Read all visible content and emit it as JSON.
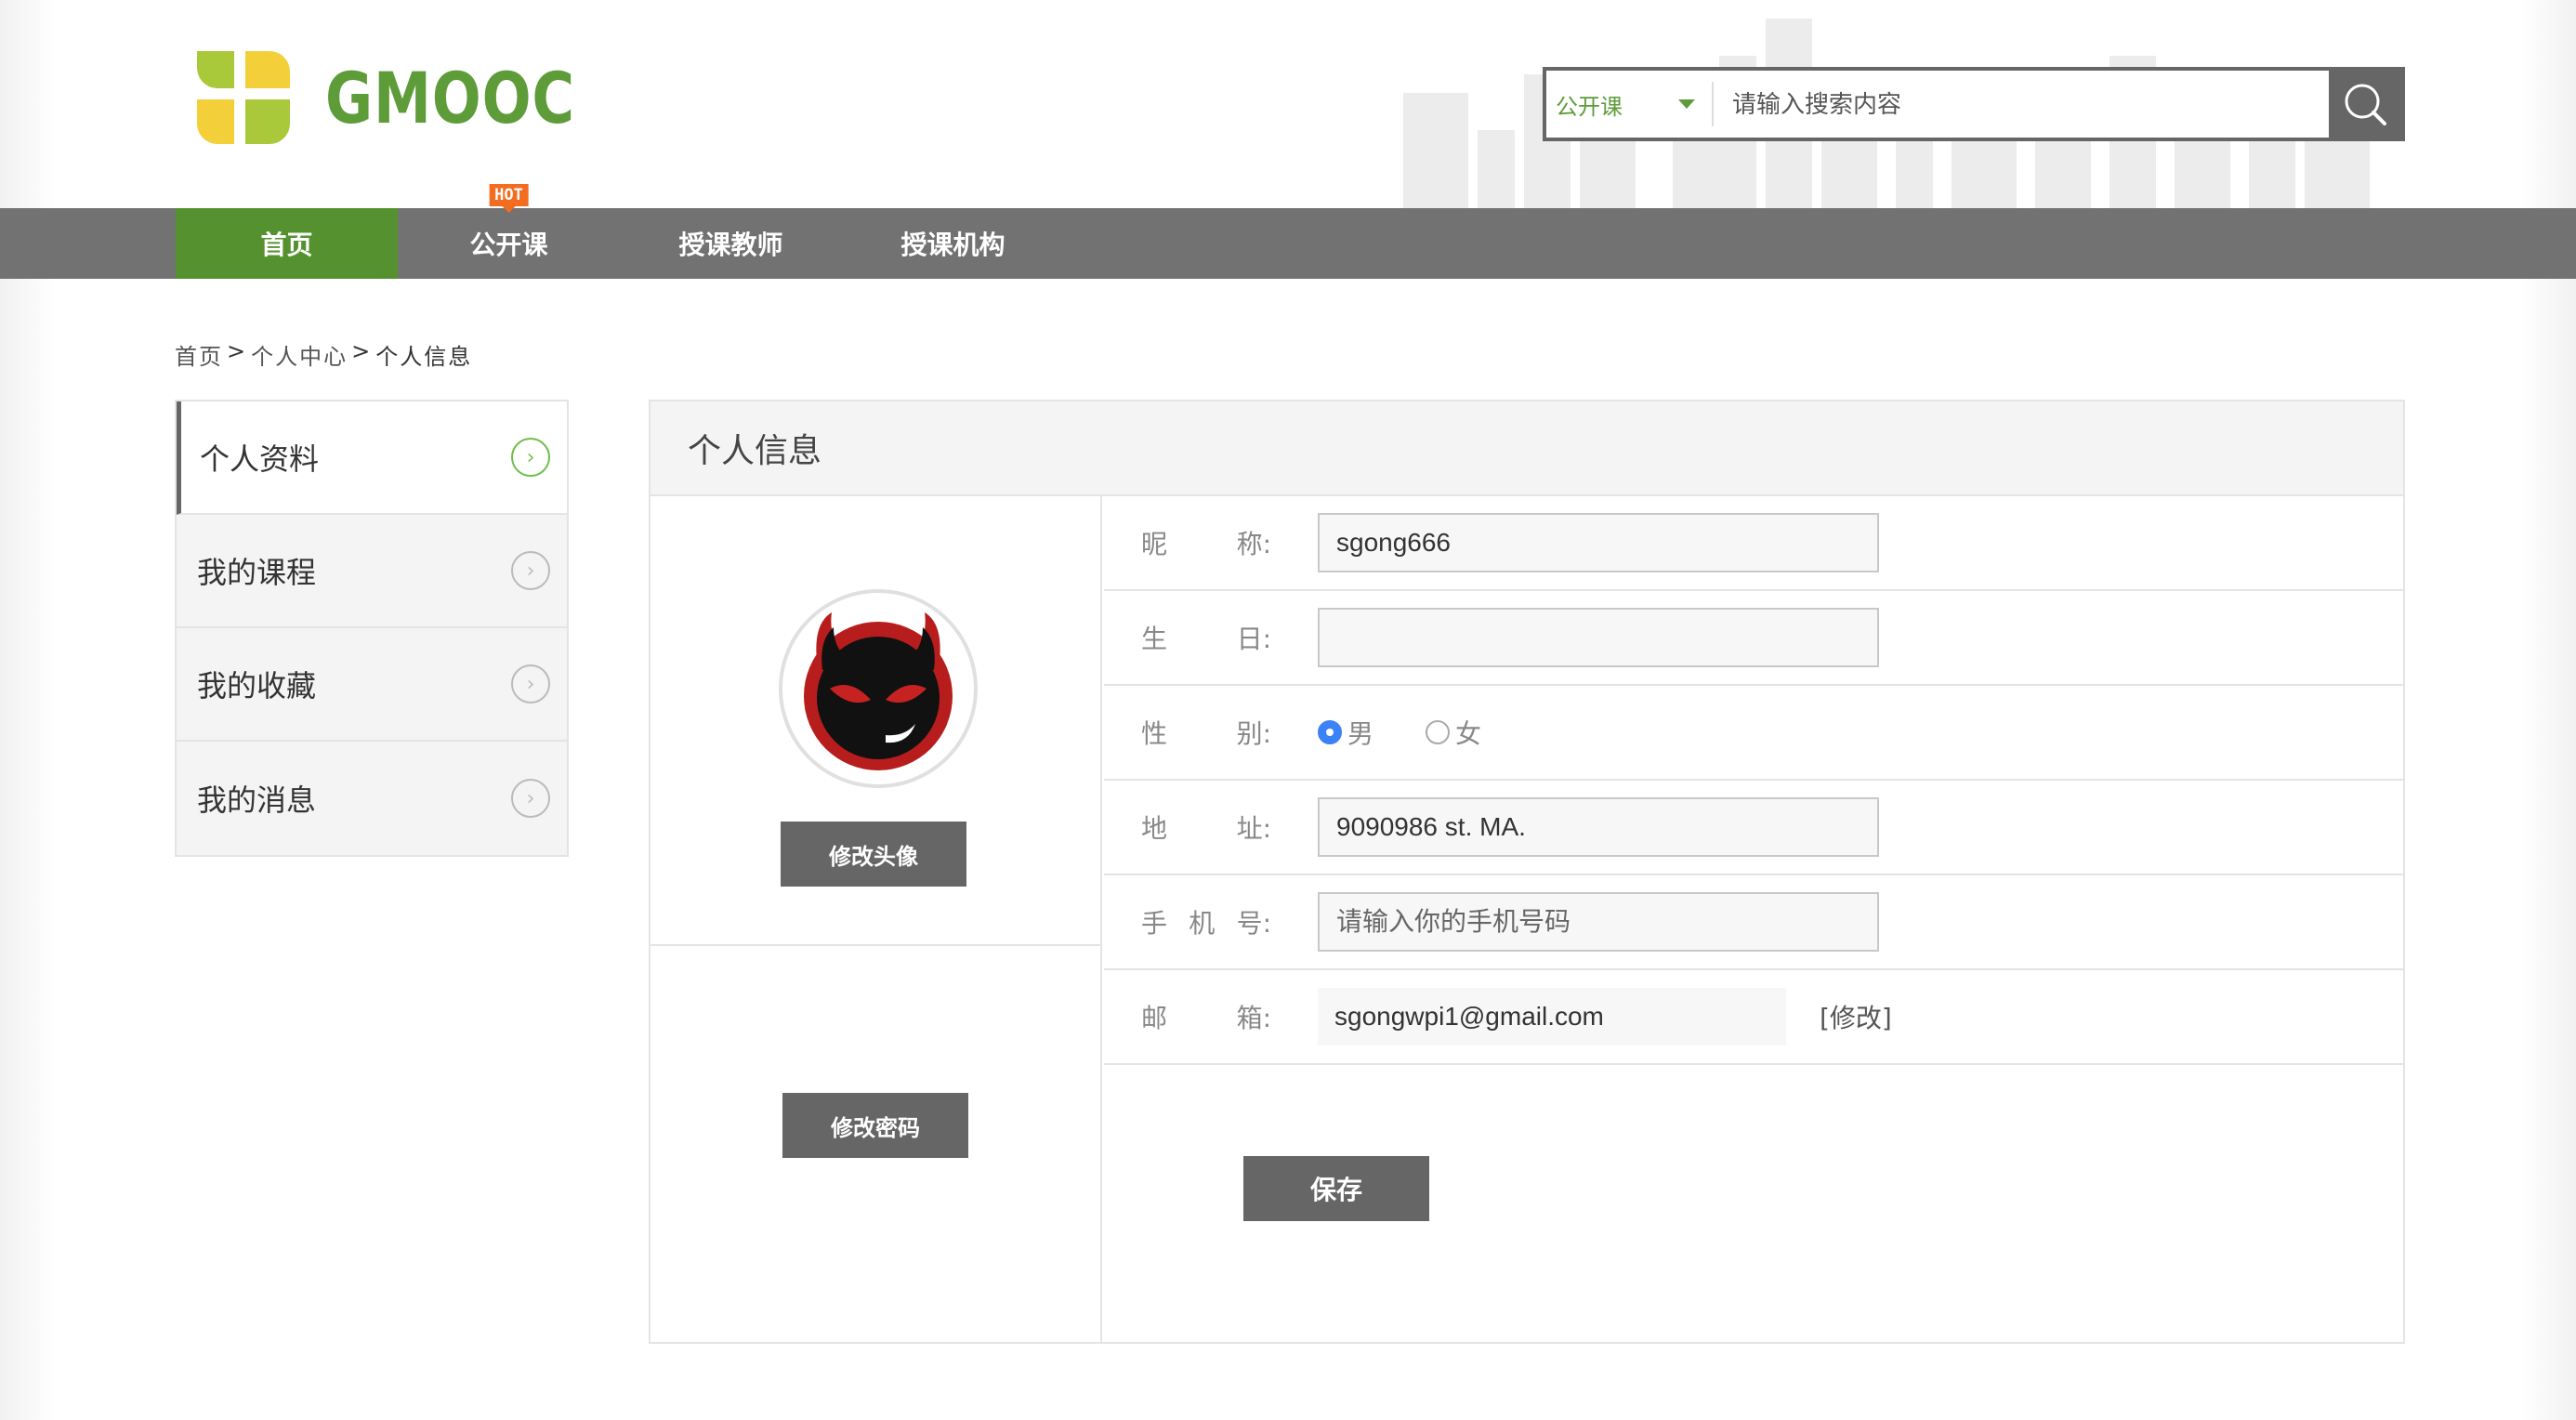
{
  "brand": {
    "name": "GMOOC"
  },
  "search": {
    "scope": "公开课",
    "placeholder": "请输入搜索内容"
  },
  "nav": {
    "items": [
      {
        "label": "首页",
        "active": true
      },
      {
        "label": "公开课",
        "badge": "HOT"
      },
      {
        "label": "授课教师"
      },
      {
        "label": "授课机构"
      }
    ]
  },
  "breadcrumb": {
    "home": "首页",
    "sep1": ">",
    "center": "个人中心",
    "sep2": ">",
    "current": "个人信息"
  },
  "sidebar": {
    "items": [
      {
        "label": "个人资料",
        "active": true
      },
      {
        "label": "我的课程"
      },
      {
        "label": "我的收藏"
      },
      {
        "label": "我的消息"
      }
    ]
  },
  "panel": {
    "title": "个人信息",
    "change_avatar": "修改头像",
    "change_password": "修改密码",
    "save": "保存"
  },
  "form": {
    "nickname": {
      "label_a": "昵",
      "label_b": "称:",
      "value": "sgong666"
    },
    "birthday": {
      "label_a": "生",
      "label_b": "日:",
      "value": ""
    },
    "gender": {
      "label_a": "性",
      "label_b": "别:",
      "options": [
        "男",
        "女"
      ],
      "selected": "男"
    },
    "address": {
      "label_a": "地",
      "label_b": "址:",
      "value": "9090986 st. MA."
    },
    "mobile": {
      "label_a": "手",
      "label_mid": "机",
      "label_b": "号:",
      "placeholder": "请输入你的手机号码"
    },
    "email": {
      "label_a": "邮",
      "label_b": "箱:",
      "value": "sgongwpi1@gmail.com",
      "edit": "[修改]"
    }
  },
  "colors": {
    "brand_green": "#55922f",
    "nav_gray": "#727272",
    "hot_orange": "#f36d21",
    "button_gray": "#666666"
  }
}
